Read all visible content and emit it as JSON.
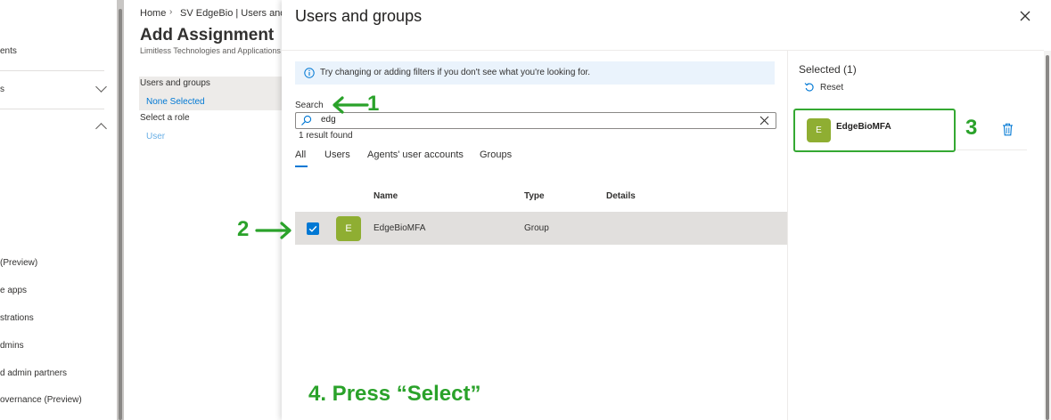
{
  "left_nav": {
    "items": [
      {
        "label": "ents"
      },
      {
        "label": "s"
      },
      {
        "label": "(Preview)"
      },
      {
        "label": "e apps"
      },
      {
        "label": "strations"
      },
      {
        "label": "dmins"
      },
      {
        "label": "d admin partners"
      },
      {
        "label": "overnance (Preview)"
      }
    ]
  },
  "assignment": {
    "breadcrumb": {
      "home": "Home",
      "separator": "›",
      "current": "SV EdgeBio | Users and g"
    },
    "title": "Add Assignment",
    "subtitle": "Limitless Technologies and Applications",
    "users_groups_label": "Users and groups",
    "users_groups_value": "None Selected",
    "role_label": "Select a role",
    "role_value": "User"
  },
  "modal": {
    "title": "Users and groups",
    "info_text": "Try changing or adding filters if you don't see what you're looking for.",
    "search": {
      "label": "Search",
      "value": "edg"
    },
    "result_count": "1 result found",
    "tabs": [
      "All",
      "Users",
      "Agents' user accounts",
      "Groups"
    ],
    "active_tab": "All",
    "columns": [
      "Name",
      "Type",
      "Details"
    ],
    "rows": [
      {
        "avatar_letter": "E",
        "name": "EdgeBioMFA",
        "type": "Group",
        "details": "",
        "checked": true
      }
    ],
    "selected_title": "Selected (1)",
    "reset_label": "Reset",
    "selected_items": [
      {
        "avatar_letter": "E",
        "name": "EdgeBioMFA"
      }
    ]
  },
  "annotations": {
    "step1": "1",
    "step2": "2",
    "step3": "3",
    "step4": "4. Press “Select”"
  },
  "colors": {
    "accent": "#0078d4",
    "annotation_green": "#2aa22a",
    "avatar_green": "#8fae32",
    "info_bg": "#eaf3fc",
    "row_selected_bg": "#e1dfdd"
  }
}
